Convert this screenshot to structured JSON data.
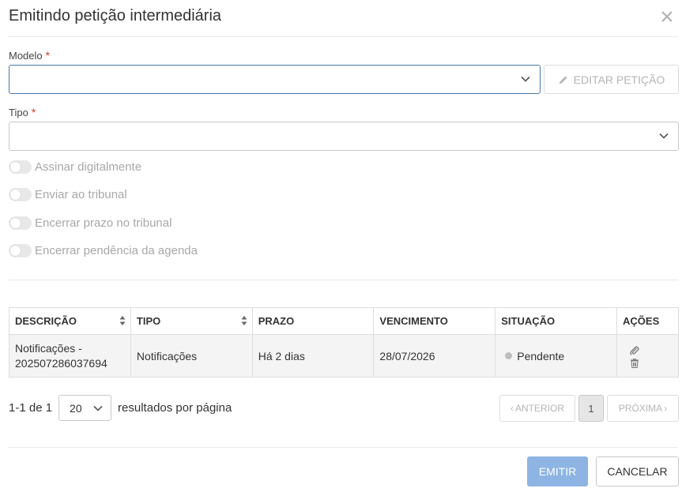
{
  "dialog": {
    "title": "Emitindo petição intermediária"
  },
  "form": {
    "modelo_label": "Modelo",
    "modelo_value": "",
    "tipo_label": "Tipo",
    "tipo_value": "",
    "required_mark": "*",
    "edit_button_label": "EDITAR PETIÇÃO"
  },
  "toggles": [
    {
      "label": "Assinar digitalmente",
      "on": false
    },
    {
      "label": "Enviar ao tribunal",
      "on": false
    },
    {
      "label": "Encerrar prazo no tribunal",
      "on": false
    },
    {
      "label": "Encerrar pendência da agenda",
      "on": false
    }
  ],
  "table": {
    "columns": [
      "DESCRIÇÃO",
      "TIPO",
      "PRAZO",
      "VENCIMENTO",
      "SITUAÇÃO",
      "AÇÕES"
    ],
    "rows": [
      {
        "descricao": "Notificações - 202507286037694",
        "tipo": "Notificações",
        "prazo": "Há 2 dias",
        "vencimento": "28/07/2026",
        "situacao": "Pendente"
      }
    ]
  },
  "pagination": {
    "range": "1-1 de 1",
    "page_size": "20",
    "page_size_suffix": "resultados por página",
    "prev_label": "ANTERIOR",
    "next_label": "PRÓXIMA",
    "current_page": "1"
  },
  "footer": {
    "emit_label": "EMITIR",
    "cancel_label": "CANCELAR"
  },
  "colors": {
    "primary_disabled": "#8db4e3",
    "due_red": "#c9302c",
    "focus_border": "#4a7aa8"
  }
}
